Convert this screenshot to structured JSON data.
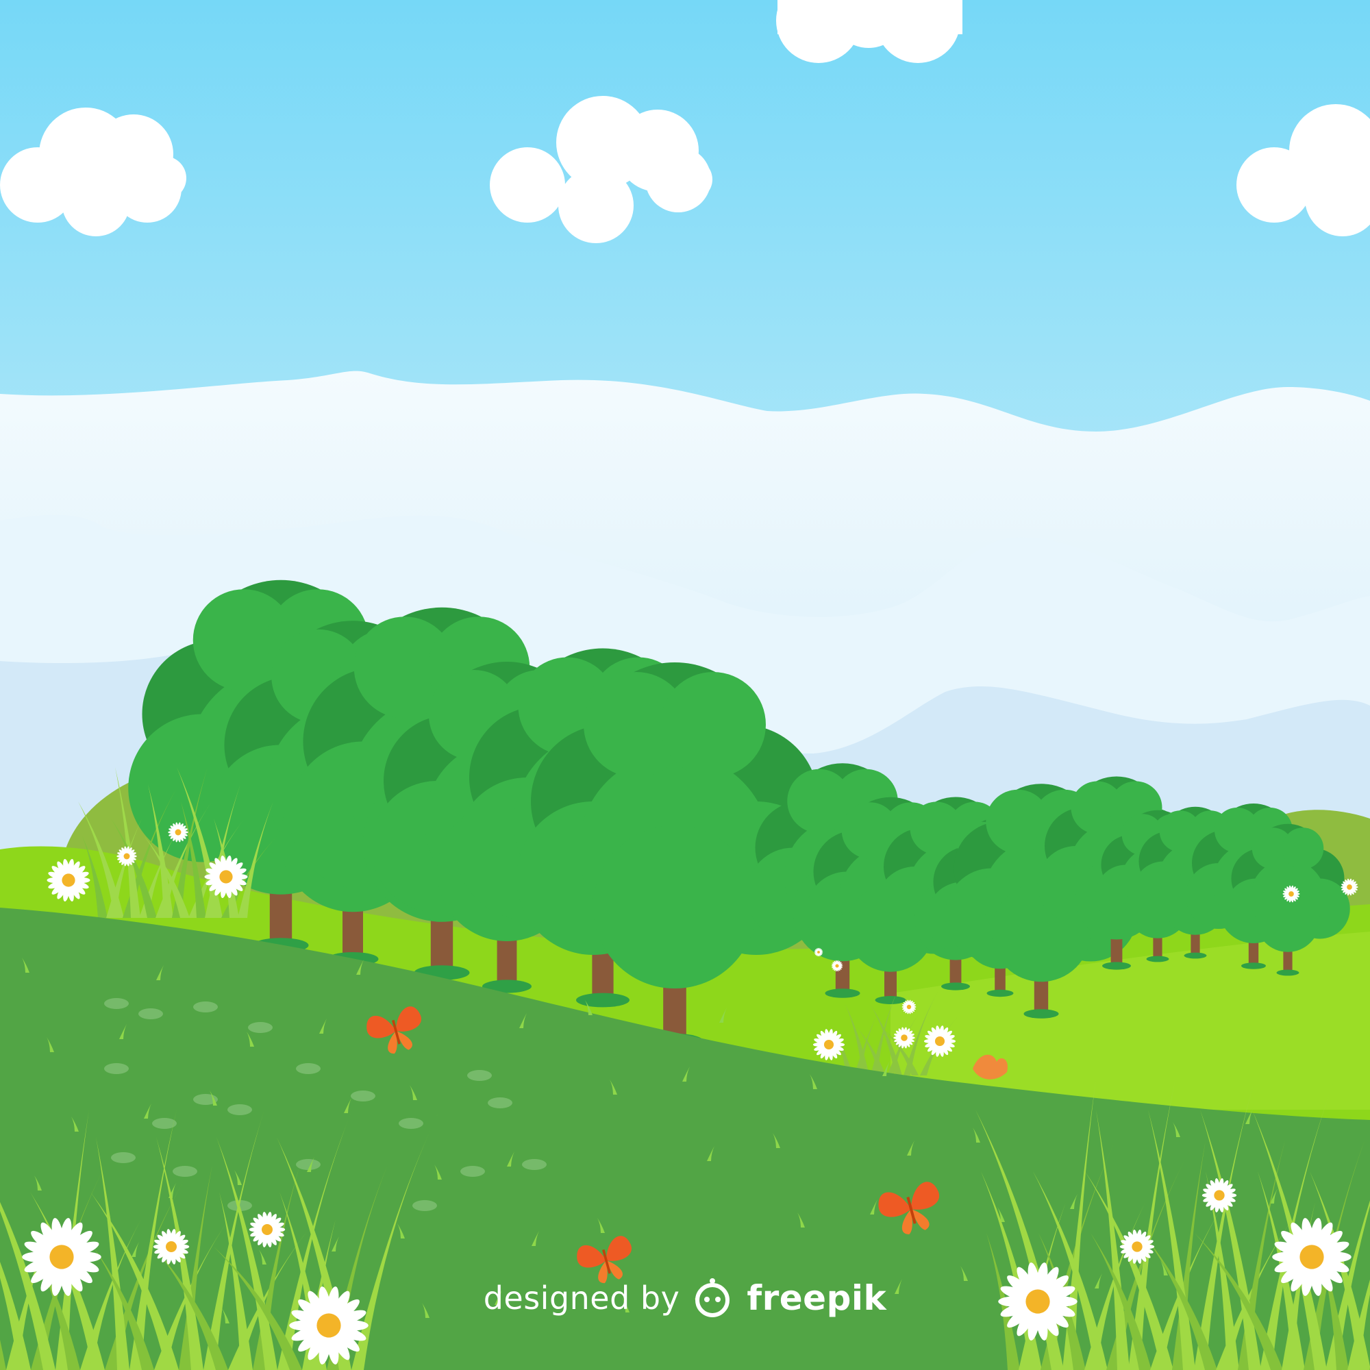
{
  "credit": {
    "prefix": "designed by",
    "brand": "freepik"
  },
  "colors": {
    "sky_top": "#76d8f7",
    "sky_bottom": "#d9f3fb",
    "mist": "#eef8fd",
    "mountain_far": "#d3e9f8",
    "hill_olive": "#8fbc40",
    "meadow_light": "#8ed71b",
    "meadow_dark": "#52a545",
    "tree_light": "#3ab44a",
    "tree_dark": "#2d9a3f",
    "trunk": "#8a5a3a",
    "daisy_petal": "#ffffff",
    "daisy_center": "#f3b428",
    "butterfly": "#ee5a24",
    "grass_blade": "#8ed74a"
  },
  "icons": [
    "cloud-icon",
    "tree-icon",
    "daisy-icon",
    "butterfly-icon",
    "freepik-logo-icon"
  ]
}
